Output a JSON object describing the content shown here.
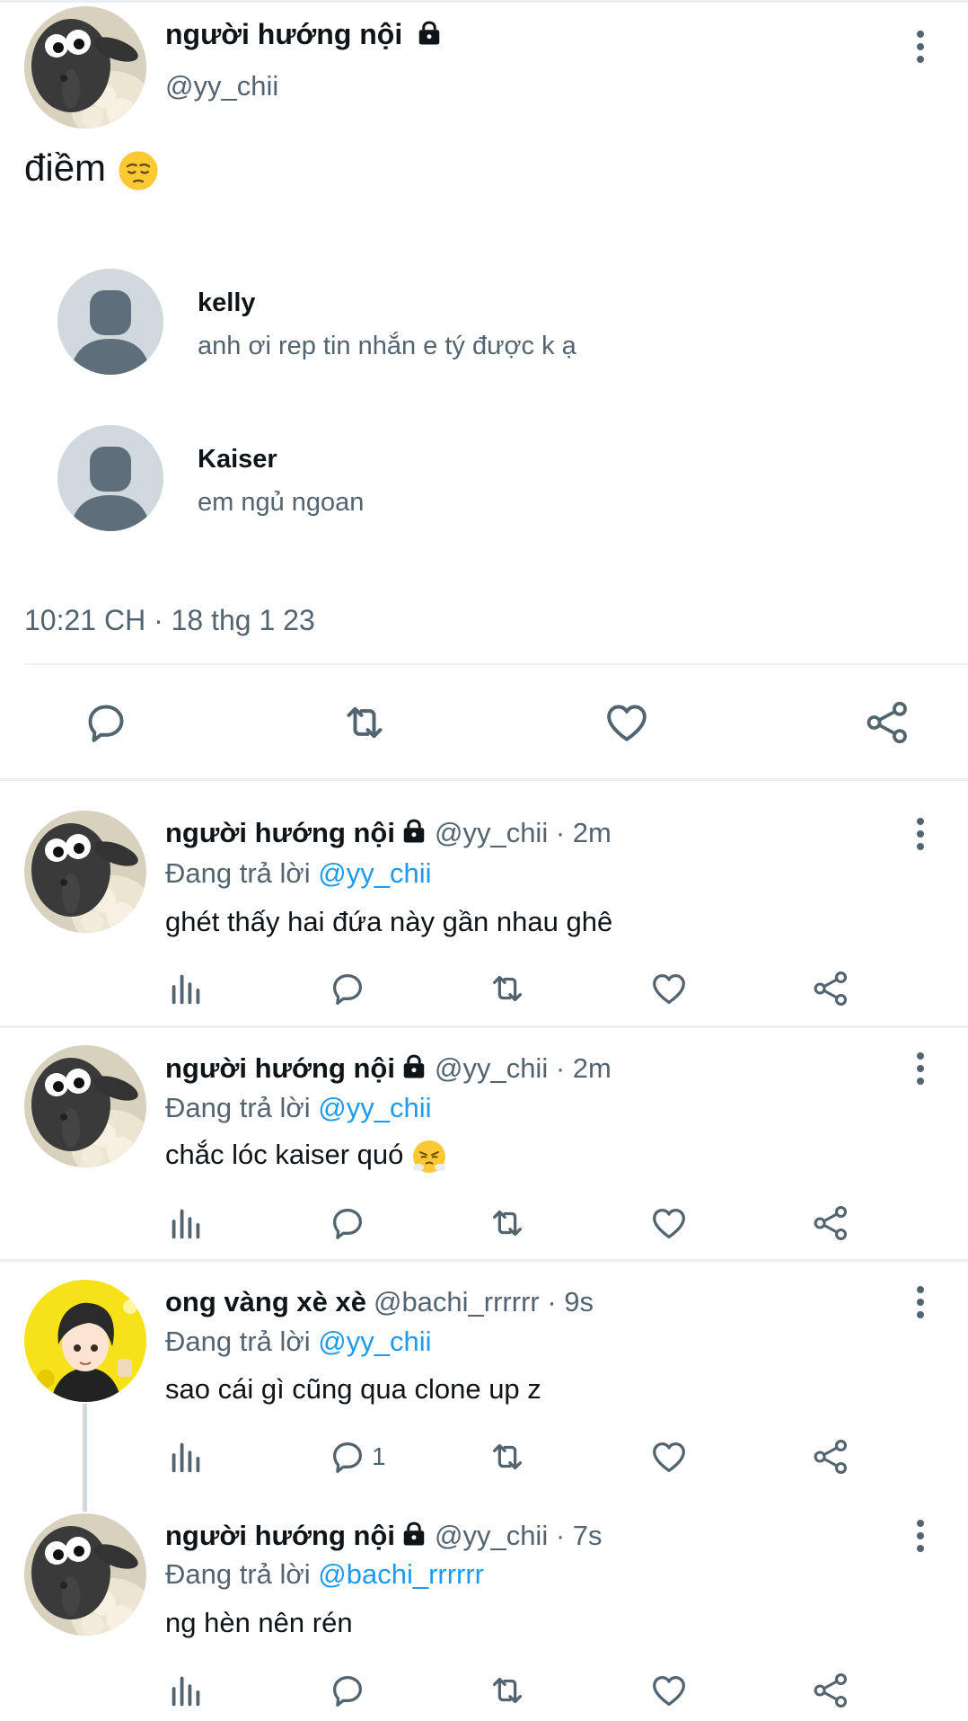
{
  "main_tweet": {
    "author_name": "người hướng nội",
    "handle": "@yy_chii",
    "text": "điềm",
    "contacts": [
      {
        "name": "kelly",
        "message": "anh ơi rep tin nhắn e tý được k ạ"
      },
      {
        "name": "Kaiser",
        "message": "em ngủ ngoan"
      }
    ],
    "timestamp": "10:21 CH · 18 thg 1 23"
  },
  "replies": [
    {
      "name": "người hướng nội",
      "handle": "@yy_chii · 2m",
      "replying_prefix": "Đang trả lời",
      "replying_to": "@yy_chii",
      "text": "ghét thấy hai đứa này gần nhau ghê",
      "reply_count": ""
    },
    {
      "name": "người hướng nội",
      "handle": "@yy_chii · 2m",
      "replying_prefix": "Đang trả lời",
      "replying_to": "@yy_chii",
      "text": "chắc lóc kaiser quó",
      "reply_count": ""
    },
    {
      "name": "ong vàng xè xè",
      "handle": "@bachi_rrrrrr · 9s",
      "replying_prefix": "Đang trả lời",
      "replying_to": "@yy_chii",
      "text": "sao cái gì cũng qua clone up z",
      "reply_count": "1"
    },
    {
      "name": "người hướng nội",
      "handle": "@yy_chii · 7s",
      "replying_prefix": "Đang trả lời",
      "replying_to": "@bachi_rrrrrr",
      "text": "ng hèn nên rén",
      "reply_count": ""
    }
  ],
  "icons": {
    "reply": "speech-bubble-icon",
    "retweet": "retweet-icon",
    "like": "heart-icon",
    "share": "share-icon",
    "analytics": "bar-chart-icon",
    "more": "more-vertical-icon",
    "protected": "lock-icon"
  },
  "colors": {
    "accent": "#1d9bf0",
    "secondary_text": "#536471",
    "primary_text": "#0f1419",
    "divider": "#eff3f4"
  }
}
